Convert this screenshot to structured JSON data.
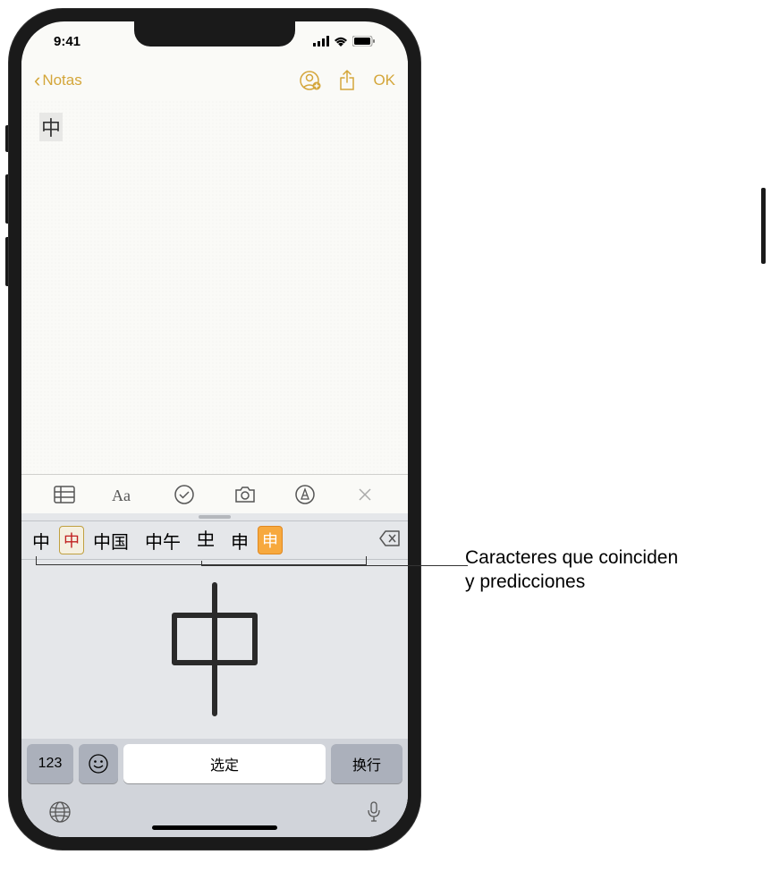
{
  "status_bar": {
    "time": "9:41"
  },
  "nav": {
    "back_label": "Notas",
    "done_label": "OK"
  },
  "note": {
    "content": "中"
  },
  "candidates": {
    "items": [
      "中",
      "中",
      "中国",
      "中午",
      "𠀐",
      "申",
      "申"
    ]
  },
  "keyboard": {
    "numbers_key": "123",
    "select_key": "选定",
    "return_key": "换行"
  },
  "callout": {
    "line1": "Caracteres que coinciden",
    "line2": "y predicciones"
  }
}
